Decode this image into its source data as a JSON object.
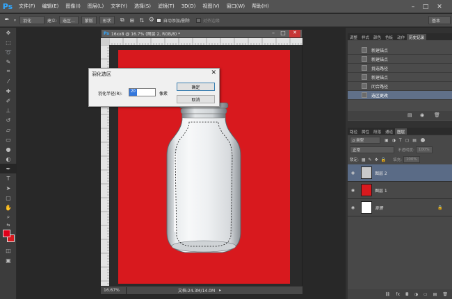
{
  "app": {
    "logo": "Ps"
  },
  "menubar": {
    "items": [
      "文件(F)",
      "编辑(E)",
      "图像(I)",
      "图层(L)",
      "文字(Y)",
      "选择(S)",
      "滤镜(T)",
      "3D(D)",
      "视图(V)",
      "窗口(W)",
      "帮助(H)"
    ]
  },
  "options_bar": {
    "feather_label": "羽化",
    "build_label": "建立:",
    "selection_btn": "选区...",
    "mask_btn": "蒙版",
    "shape_btn": "形状",
    "auto_add_delete": "自动添加/删除",
    "align_edges": "对齐边缘",
    "workspace": "基本"
  },
  "document": {
    "tab_title": "16xx8 @ 16.7% (图层 2, RGB/8) *",
    "zoom": "16.67%",
    "doc_size": "文档:24.3M/14.0M",
    "canvas_color": "#d8191e"
  },
  "dialog": {
    "title": "羽化选区",
    "radius_label": "羽化半径(R):",
    "radius_value": "20",
    "unit": "像素",
    "ok": "确定",
    "cancel": "取消"
  },
  "history_panel": {
    "tabs": [
      "调整",
      "样式",
      "颜色",
      "色板",
      "动作",
      "历史记录"
    ],
    "active_tab": "历史记录",
    "items": [
      "新建锚点",
      "新建锚点",
      "拢选路径",
      "新建锚点",
      "闭合路径",
      "选区更改"
    ]
  },
  "layers_panel": {
    "tabs": [
      "路径",
      "属性",
      "段落",
      "通道",
      "图层"
    ],
    "active_tab": "图层",
    "filter": "ρ 类型",
    "blend_mode": "正常",
    "opacity_label": "不透明度:",
    "opacity": "100%",
    "lock_label": "锁定:",
    "fill_label": "填充:",
    "fill": "100%",
    "layers": [
      {
        "name": "图层 2",
        "selected": true,
        "thumb": "#c9c9c9"
      },
      {
        "name": "图层 1",
        "selected": false,
        "thumb": "#d8191e"
      },
      {
        "name": "背景",
        "selected": false,
        "thumb": "#ffffff"
      }
    ]
  },
  "colors": {
    "foreground": "#e2001a",
    "background": "#d8191e",
    "selection_blue": "#3377dd"
  }
}
